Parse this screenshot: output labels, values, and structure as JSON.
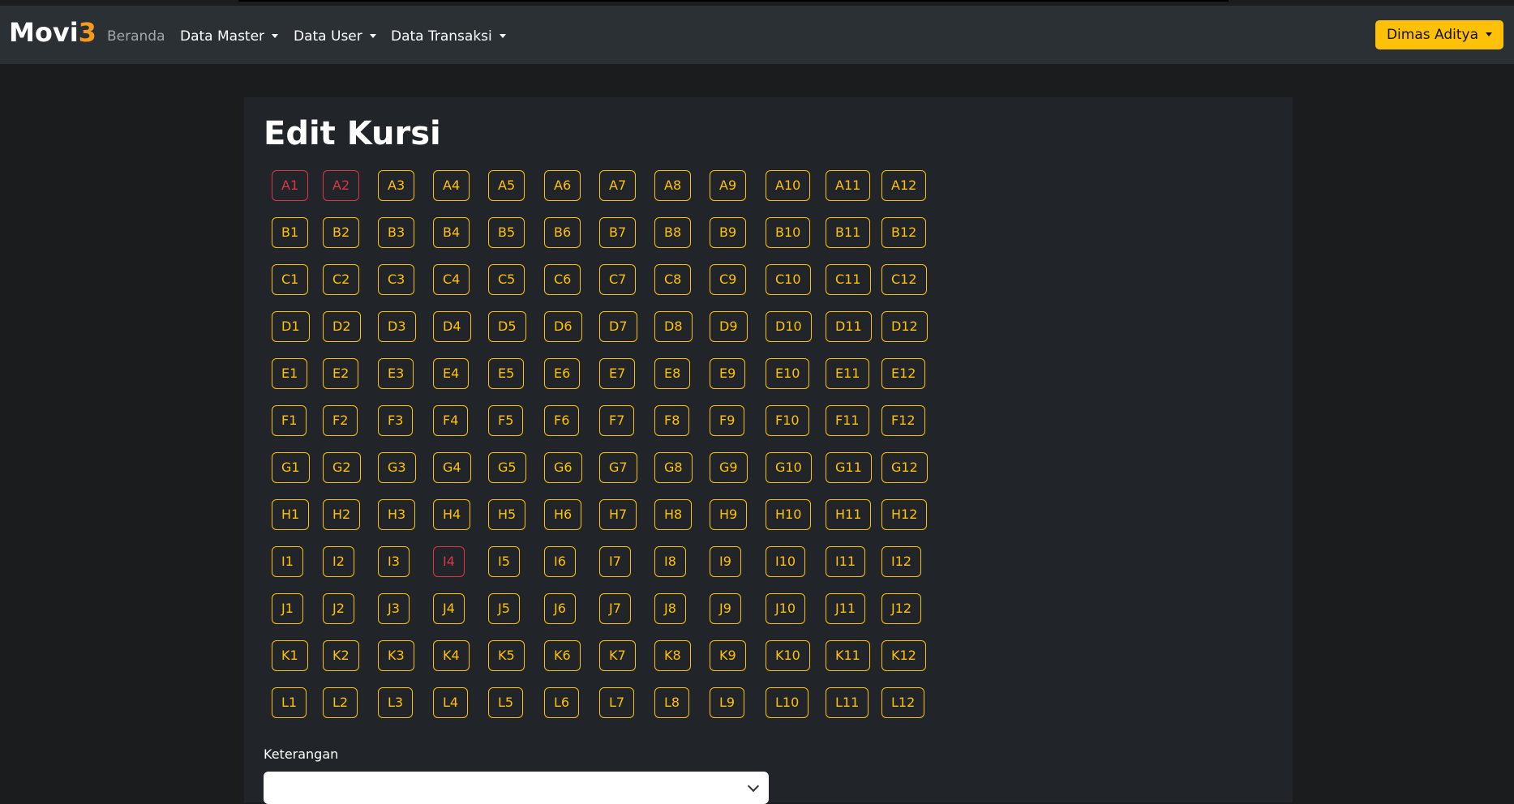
{
  "brand": {
    "name": "Movi",
    "accent": "3"
  },
  "nav": {
    "beranda": "Beranda",
    "data_master": "Data Master",
    "data_user": "Data User",
    "data_transaksi": "Data Transaksi"
  },
  "user_menu": {
    "label": "Dimas Aditya"
  },
  "page": {
    "title": "Edit Kursi"
  },
  "seats": {
    "rows": [
      [
        "A1",
        "A2",
        "A3",
        "A4",
        "A5",
        "A6",
        "A7",
        "A8",
        "A9",
        "A10",
        "A11",
        "A12"
      ],
      [
        "B1",
        "B2",
        "B3",
        "B4",
        "B5",
        "B6",
        "B7",
        "B8",
        "B9",
        "B10",
        "B11",
        "B12"
      ],
      [
        "C1",
        "C2",
        "C3",
        "C4",
        "C5",
        "C6",
        "C7",
        "C8",
        "C9",
        "C10",
        "C11",
        "C12"
      ],
      [
        "D1",
        "D2",
        "D3",
        "D4",
        "D5",
        "D6",
        "D7",
        "D8",
        "D9",
        "D10",
        "D11",
        "D12"
      ],
      [
        "E1",
        "E2",
        "E3",
        "E4",
        "E5",
        "E6",
        "E7",
        "E8",
        "E9",
        "E10",
        "E11",
        "E12"
      ],
      [
        "F1",
        "F2",
        "F3",
        "F4",
        "F5",
        "F6",
        "F7",
        "F8",
        "F9",
        "F10",
        "F11",
        "F12"
      ],
      [
        "G1",
        "G2",
        "G3",
        "G4",
        "G5",
        "G6",
        "G7",
        "G8",
        "G9",
        "G10",
        "G11",
        "G12"
      ],
      [
        "H1",
        "H2",
        "H3",
        "H4",
        "H5",
        "H6",
        "H7",
        "H8",
        "H9",
        "H10",
        "H11",
        "H12"
      ],
      [
        "I1",
        "I2",
        "I3",
        "I4",
        "I5",
        "I6",
        "I7",
        "I8",
        "I9",
        "I10",
        "I11",
        "I12"
      ],
      [
        "J1",
        "J2",
        "J3",
        "J4",
        "J5",
        "J6",
        "J7",
        "J8",
        "J9",
        "J10",
        "J11",
        "J12"
      ],
      [
        "K1",
        "K2",
        "K3",
        "K4",
        "K5",
        "K6",
        "K7",
        "K8",
        "K9",
        "K10",
        "K11",
        "K12"
      ],
      [
        "L1",
        "L2",
        "L3",
        "L4",
        "L5",
        "L6",
        "L7",
        "L8",
        "L9",
        "L10",
        "L11",
        "L12"
      ]
    ],
    "taken": [
      "A1",
      "A2",
      "I4"
    ]
  },
  "form": {
    "keterangan_label": "Keterangan",
    "keterangan_value": ""
  },
  "colors": {
    "navbar_bg": "#2b3035",
    "page_bg": "#1b1c1e",
    "card_bg": "#212529",
    "accent_yellow": "#ffc107",
    "taken_red": "#dc3545",
    "brand_accent": "#f49a1d"
  },
  "icons": {
    "dropdown": "caret-down-icon",
    "select": "chevron-down-icon"
  }
}
